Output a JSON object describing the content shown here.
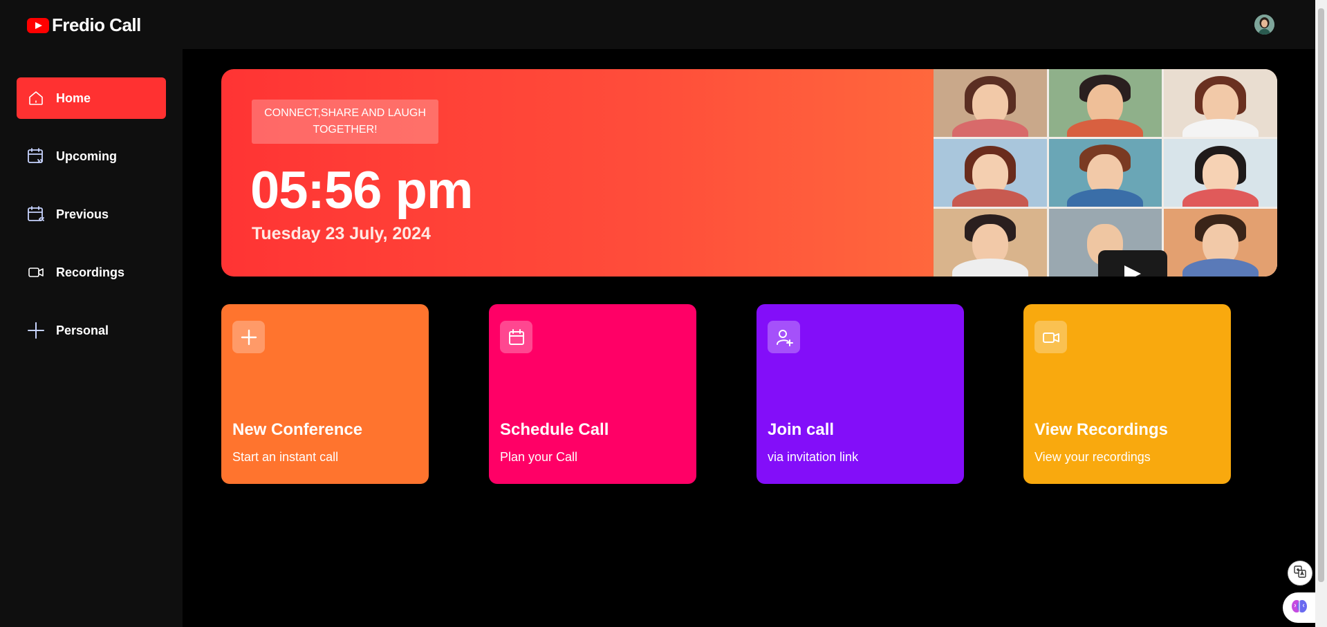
{
  "app": {
    "name": "Fredio Call"
  },
  "sidebar": {
    "items": [
      {
        "label": "Home",
        "icon": "home-icon",
        "active": true
      },
      {
        "label": "Upcoming",
        "icon": "calendar-forward-icon",
        "active": false
      },
      {
        "label": "Previous",
        "icon": "calendar-back-icon",
        "active": false
      },
      {
        "label": "Recordings",
        "icon": "video-icon",
        "active": false
      },
      {
        "label": "Personal",
        "icon": "plus-icon",
        "active": false
      }
    ]
  },
  "hero": {
    "tagline": "CONNECT,SHARE AND LAUGH TOGETHER!",
    "time": "05:56 pm",
    "date": "Tuesday 23 July, 2024"
  },
  "cards": [
    {
      "title": "New Conference",
      "subtitle": "Start an instant call",
      "icon": "plus-icon",
      "color": "#ff742e"
    },
    {
      "title": "Schedule Call",
      "subtitle": "Plan your Call",
      "icon": "calendar-icon",
      "color": "#ff0066"
    },
    {
      "title": "Join call",
      "subtitle": "via invitation link",
      "icon": "user-plus-icon",
      "color": "#830ef9"
    },
    {
      "title": "View Recordings",
      "subtitle": "View your recordings",
      "icon": "video-icon",
      "color": "#f9a90e"
    }
  ],
  "colors": {
    "accent": "#ff3131",
    "topbar": "#0f0f0f",
    "background": "#000000"
  }
}
